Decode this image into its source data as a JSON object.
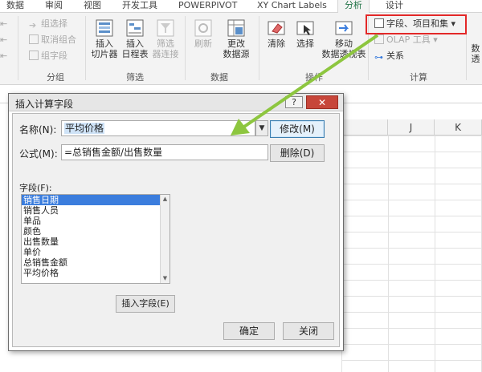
{
  "ribbon_tabs": [
    "数据",
    "审阅",
    "视图",
    "开发工具",
    "POWERPIVOT",
    "XY Chart Labels",
    "分析",
    "设计"
  ],
  "ribbon": {
    "group_left": {
      "items": [
        "组选择",
        "取消组合",
        "组字段"
      ],
      "label": "分组"
    },
    "group_filter": {
      "buttons": [
        "插入\n切片器",
        "插入\n日程表",
        "筛选\n器连接"
      ],
      "label": "筛选"
    },
    "group_data": {
      "buttons": [
        "刷新",
        "更改\n数据源"
      ],
      "label": "数据"
    },
    "group_actions": {
      "buttons": [
        "清除",
        "选择",
        "移动\n数据透视表"
      ],
      "label": "操作"
    },
    "group_calc": {
      "items": [
        "字段、项目和集",
        "OLAP 工具",
        "关系"
      ],
      "label": "计算"
    },
    "truncated_right": [
      "数",
      "透"
    ]
  },
  "grid": {
    "column_headers": [
      "J",
      "K"
    ]
  },
  "dialog": {
    "title": "插入计算字段",
    "help_label": "?",
    "close_label": "✕",
    "name_label": "名称(N):",
    "name_value": "平均价格",
    "formula_label": "公式(M):",
    "formula_value": "=总销售金额/出售数量",
    "modify_button": "修改(M)",
    "delete_button": "删除(D)",
    "fields_label": "字段(F):",
    "fields": [
      "销售日期",
      "销售人员",
      "单品",
      "颜色",
      "出售数量",
      "单价",
      "总销售金额",
      "平均价格"
    ],
    "selected_field": "销售日期",
    "insert_field_button": "插入字段(E)",
    "ok_button": "确定",
    "close_button": "关闭"
  },
  "colors": {
    "highlight_border": "#e32828",
    "arrow": "#8dc63f",
    "active_tab": "#217346",
    "selection": "#3b7ddd"
  }
}
